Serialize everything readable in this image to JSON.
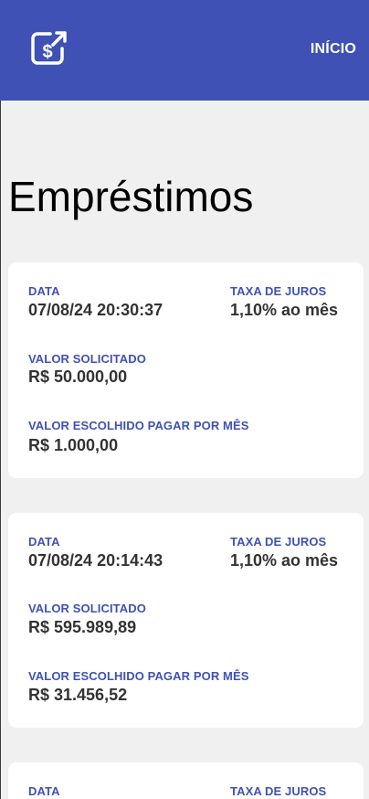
{
  "header": {
    "logo_icon": "dollar-transfer-icon",
    "nav_inicio": "INÍCIO",
    "color": "#3f51b5"
  },
  "page_title": "Empréstimos",
  "labels": {
    "data": "DATA",
    "taxa": "TAXA DE JUROS",
    "valor_solicitado": "VALOR SOLICITADO",
    "valor_pagar": "VALOR ESCOLHIDO PAGAR POR MÊS"
  },
  "loans": [
    {
      "date": "07/08/24 20:30:37",
      "rate": "1,10% ao mês",
      "requested": "R$ 50.000,00",
      "monthly": "R$ 1.000,00"
    },
    {
      "date": "07/08/24 20:14:43",
      "rate": "1,10% ao mês",
      "requested": "R$ 595.989,89",
      "monthly": "R$ 31.456,52"
    },
    {
      "date": "",
      "rate": "",
      "requested": "",
      "monthly": ""
    }
  ]
}
